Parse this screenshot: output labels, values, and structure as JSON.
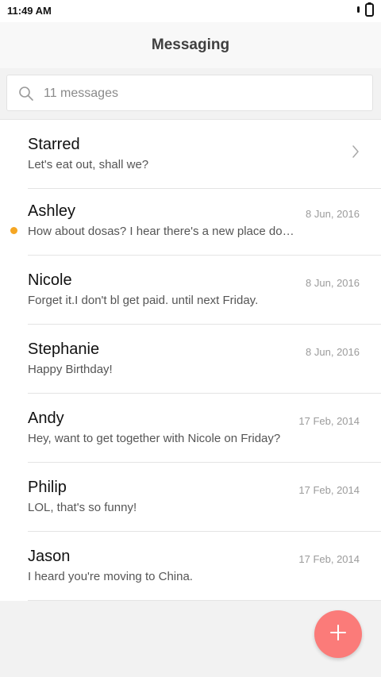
{
  "status_bar": {
    "time": "11:49 AM",
    "icons": [
      "bluetooth-icon",
      "battery-icon"
    ]
  },
  "header": {
    "title": "Messaging"
  },
  "search": {
    "placeholder": "11 messages",
    "icon": "search-icon"
  },
  "messages": [
    {
      "name": "Starred",
      "preview": "Let's eat out, shall we?",
      "date": ""
    },
    {
      "name": "Ashley",
      "preview": "How about dosas? I hear there's a new place do…",
      "date": "8 Jun, 2016"
    },
    {
      "name": "Nicole",
      "preview": "Forget it.I don't bl get paid. until next Friday.",
      "date": "8 Jun, 2016"
    },
    {
      "name": "Stephanie",
      "preview": "Happy Birthday!",
      "date": "8 Jun, 2016",
      "unread": true
    },
    {
      "name": "Andy",
      "preview": "Hey, want to get together with Nicole on Friday?",
      "date": "17 Feb, 2014"
    },
    {
      "name": "Philip",
      "preview": "LOL, that's so funny!",
      "date": "17 Feb, 2014"
    },
    {
      "name": "Jason",
      "preview": "I heard you're moving to China.",
      "date": "17 Feb, 2014"
    }
  ],
  "fab": {
    "icon": "plus-icon"
  },
  "colors": {
    "accent": "#fb7b79",
    "unread_dot": "#f5a623",
    "title_text": "#3f3f3f",
    "date_text": "#9b9b9b"
  }
}
